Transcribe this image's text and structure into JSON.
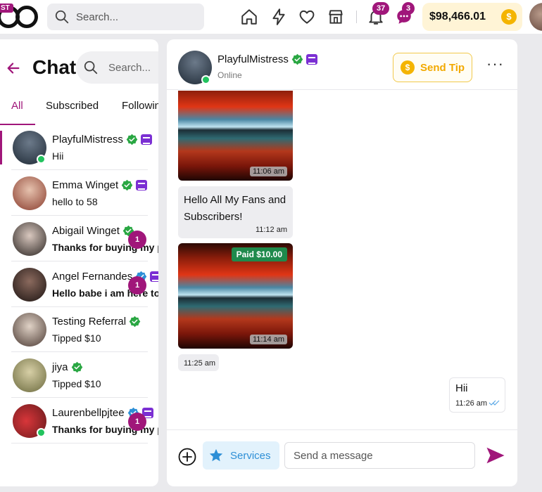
{
  "topbar": {
    "logo_badge": "ST",
    "search_placeholder": "Search...",
    "notifications_count": "37",
    "messages_count": "3",
    "balance": "$98,466.01",
    "coin_symbol": "$"
  },
  "chat_list": {
    "title": "Chat",
    "search_placeholder": "Search...",
    "tabs": [
      "All",
      "Subscribed",
      "Following"
    ],
    "items": [
      {
        "name": "PlayfulMistress",
        "message": "Hii",
        "bold": false,
        "unread": ""
      },
      {
        "name": "Emma Winget",
        "message": "hello to 58",
        "bold": false,
        "unread": ""
      },
      {
        "name": "Abigail Winget",
        "message": "Thanks for buying my p",
        "bold": true,
        "unread": "1"
      },
      {
        "name": "Angel Fernandes",
        "message": "Hello babe i am here to",
        "bold": true,
        "unread": "1"
      },
      {
        "name": "Testing Referral",
        "message": "Tipped $10",
        "bold": false,
        "unread": ""
      },
      {
        "name": "jiya",
        "message": "Tipped $10",
        "bold": false,
        "unread": ""
      },
      {
        "name": "Laurenbellpjtee",
        "message": "Thanks for buying my p",
        "bold": true,
        "unread": "1"
      }
    ]
  },
  "conversation": {
    "contact_name": "PlayfulMistress",
    "status": "Online",
    "send_tip_label": "Send Tip",
    "messages": [
      {
        "type": "image",
        "time": "11:06 am"
      },
      {
        "type": "text",
        "text": "Hello All My Fans and Subscribers!",
        "time": "11:12 am"
      },
      {
        "type": "image",
        "paid_label": "Paid $10.00",
        "time": "11:14 am"
      },
      {
        "type": "time",
        "time": "11:25 am"
      },
      {
        "type": "outgoing",
        "text": "Hii",
        "time": "11:26 am"
      }
    ],
    "services_label": "Services",
    "input_placeholder": "Send a message"
  },
  "colors": {
    "accent": "#a0167a",
    "online": "#22c35e",
    "verified": "#2aa743",
    "crown": "#7b2fd3",
    "tip_gold": "#f2a900",
    "services_blue": "#2d8fd6"
  }
}
